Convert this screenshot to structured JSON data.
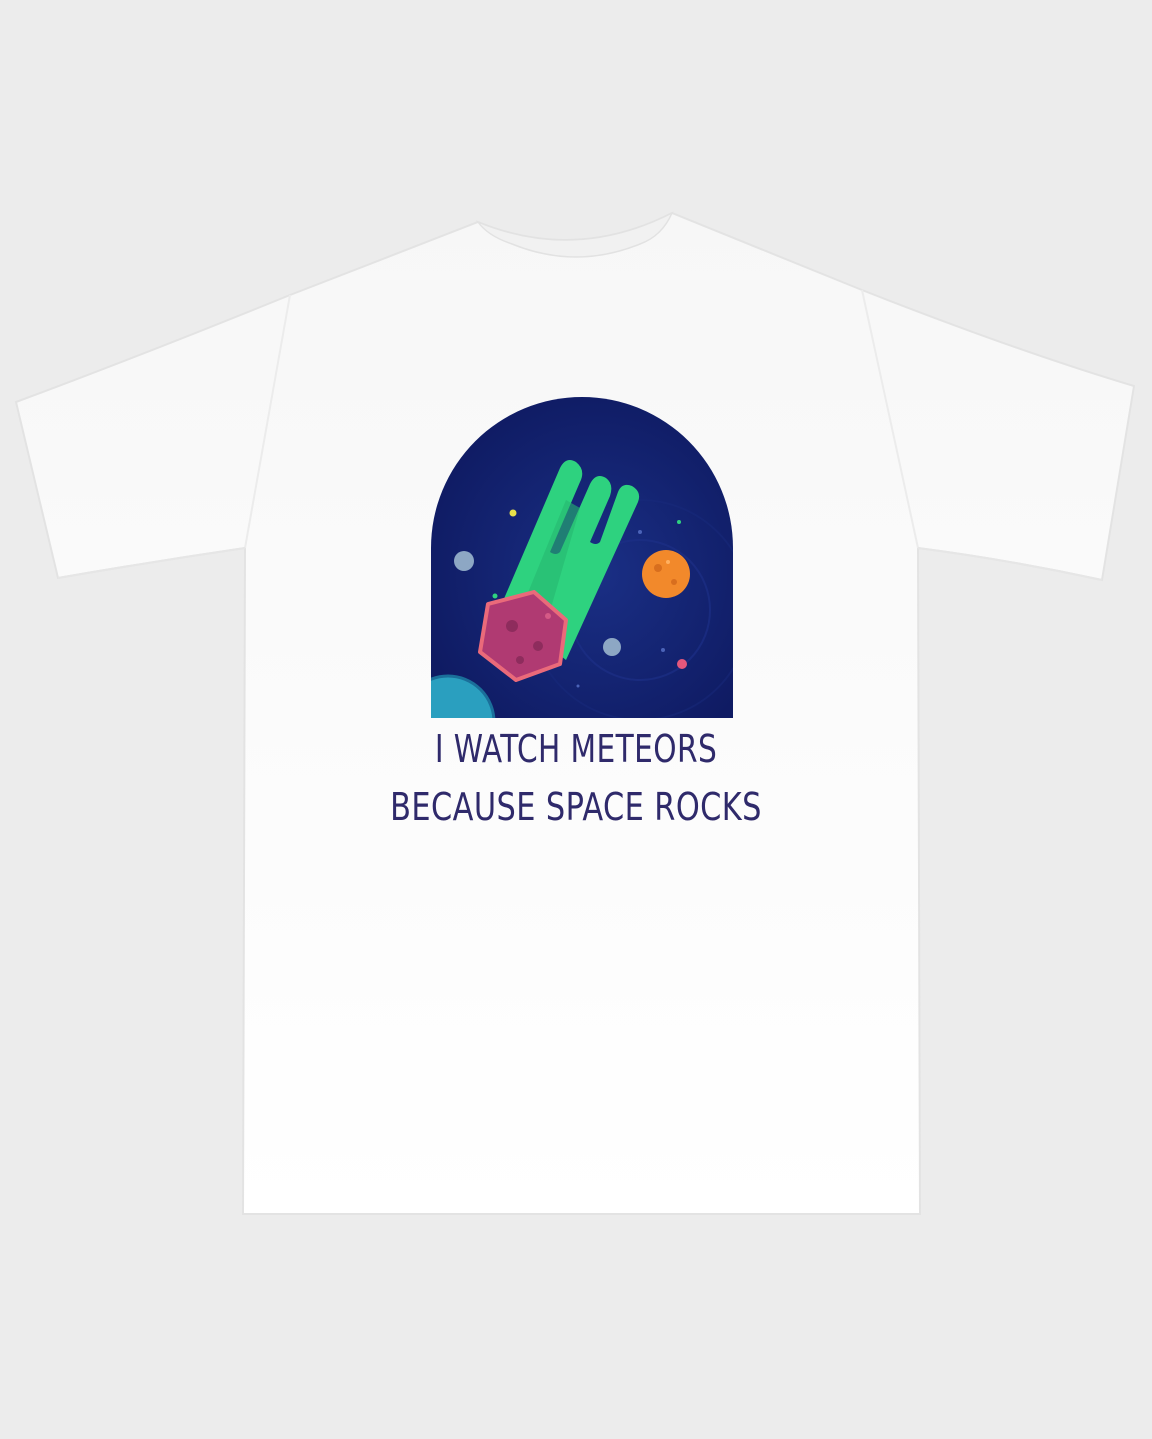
{
  "product": {
    "type": "t-shirt",
    "shirt_color": "#ffffff",
    "background_color": "#ececec"
  },
  "design": {
    "graphic": "meteor-in-arched-window-icon",
    "colors": {
      "space": "#0f1b63",
      "meteor_tail": "#2ed27f",
      "meteor_rock": "#b03a72",
      "planet_orange": "#f2892b",
      "text": "#2f2a6b"
    },
    "slogan_line1": "I WATCH METEORS",
    "slogan_line2": "BECAUSE SPACE ROCKS"
  }
}
